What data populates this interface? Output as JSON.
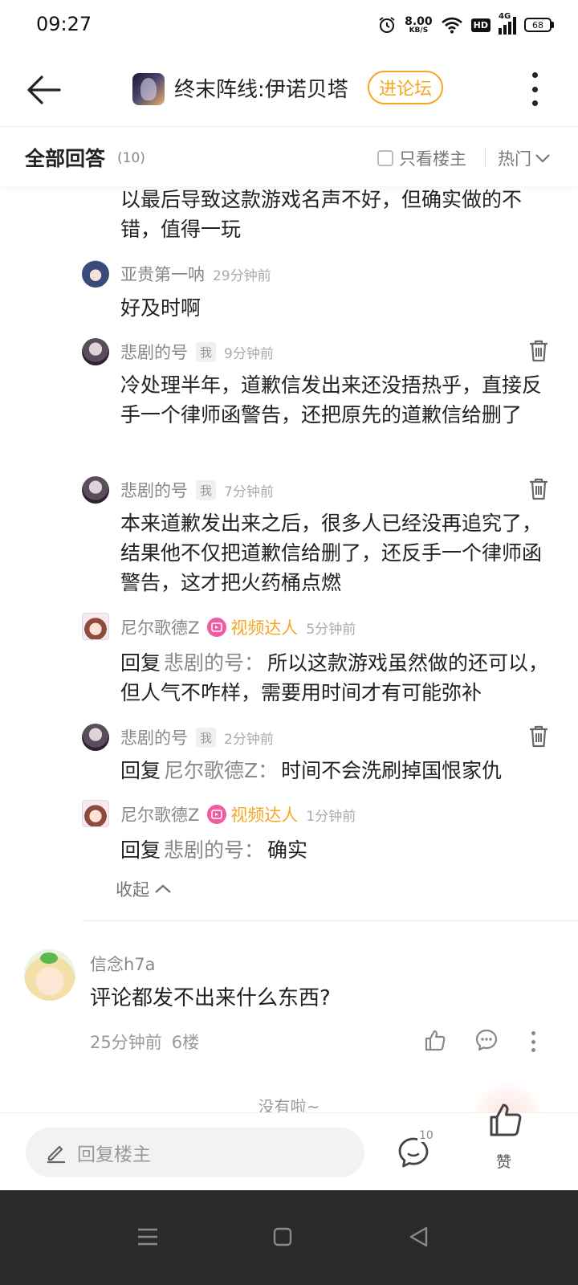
{
  "status_bar": {
    "time": "09:27",
    "net_speed_value": "8.00",
    "net_speed_unit": "KB/S",
    "hd": "HD",
    "signal": "4G",
    "battery": "68"
  },
  "header": {
    "game_title": "终末阵线:伊诺贝塔",
    "forum_button": "进论坛"
  },
  "answers_bar": {
    "title": "全部回答",
    "count": "(10)",
    "only_op_label": "只看楼主",
    "sort_label": "热门"
  },
  "continued_reply": {
    "text": "以最后导致这款游戏名声不好，但确实做的不错，值得一玩"
  },
  "replies": [
    {
      "username": "亚贵第一呐",
      "badge": "",
      "time": "29分钟前",
      "text": "好及时啊"
    },
    {
      "username": "悲剧的号",
      "badge": "我",
      "time": "9分钟前",
      "text": "冷处理半年，道歉信发出来还没捂热乎，直接反手一个律师函警告，还把原先的道歉信给删了"
    },
    {
      "username": "悲剧的号",
      "badge": "我",
      "time": "7分钟前",
      "text": "本来道歉发出来之后，很多人已经没再追究了，结果他不仅把道歉信给删了，还反手一个律师函警告，这才把火药桶点燃"
    },
    {
      "username": "尼尔歌德Z",
      "vip_badge": "视频达人",
      "time": "5分钟前",
      "reply_word": "回复",
      "reply_to": "悲剧的号：",
      "text": "所以这款游戏虽然做的还可以，但人气不咋样，需要用时间才有可能弥补"
    },
    {
      "username": "悲剧的号",
      "badge": "我",
      "time": "2分钟前",
      "reply_word": "回复",
      "reply_to": "尼尔歌德Z：",
      "text": "时间不会洗刷掉国恨家仇"
    },
    {
      "username": "尼尔歌德Z",
      "vip_badge": "视频达人",
      "time": "1分钟前",
      "reply_word": "回复",
      "reply_to": "悲剧的号：",
      "text": "确实"
    }
  ],
  "collapse_label": "收起",
  "main_comment": {
    "username": "信念h7a",
    "text": "评论都发不出来什么东西?",
    "time": "25分钟前",
    "floor": "6楼"
  },
  "end_text": "没有啦~",
  "bottom_bar": {
    "reply_placeholder": "回复楼主",
    "comment_count": "10",
    "like_label": "赞"
  },
  "colors": {
    "accent": "#f5a623",
    "video_badge": "#f25aa2",
    "nav_bar": "#2a2a2a"
  }
}
